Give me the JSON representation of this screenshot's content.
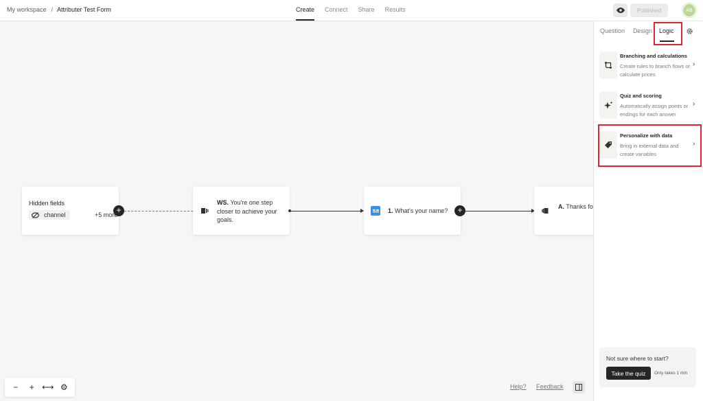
{
  "header": {
    "workspace": "My workspace",
    "separator": "/",
    "form_title": "Attributer Test Form",
    "tabs": [
      "Create",
      "Connect",
      "Share",
      "Results"
    ],
    "active_tab": "Create",
    "publish_label": "Published",
    "avatar_initials": "AB"
  },
  "canvas": {
    "hidden_fields": {
      "title": "Hidden fields",
      "chip": "channel",
      "more": "+5 more"
    },
    "welcome": {
      "ref": "WS.",
      "text": "You're one step closer to achieve your goals."
    },
    "question": {
      "ref": "1.",
      "text": "What's your name?"
    },
    "ending": {
      "ref": "A.",
      "text": "Thanks fo interest!"
    },
    "zoom_controls": [
      "−",
      "+",
      "⟷",
      "⚙"
    ],
    "help_label": "Help?",
    "feedback_label": "Feedback"
  },
  "panel": {
    "tabs": [
      "Question",
      "Design",
      "Logic"
    ],
    "active_tab": "Logic",
    "cards": [
      {
        "title": "Branching and calculations",
        "description": "Create rules to branch flows or calculate prices",
        "icon": "branch-icon"
      },
      {
        "title": "Quiz and scoring",
        "description": "Automatically assign points or endings for each answer",
        "icon": "sparkle-icon"
      },
      {
        "title": "Personalize with data",
        "description": "Bring in external data and create variables",
        "icon": "tag-icon"
      }
    ],
    "quiz_prompt": "Not sure where to start?",
    "quiz_button": "Take the quiz",
    "quiz_note": "Only takes 1 min"
  },
  "colors": {
    "accent_dark": "#262627",
    "highlight_red": "#e0232e",
    "question_icon_blue": "#3d8fe6",
    "canvas_bg": "#f6f6f6"
  }
}
